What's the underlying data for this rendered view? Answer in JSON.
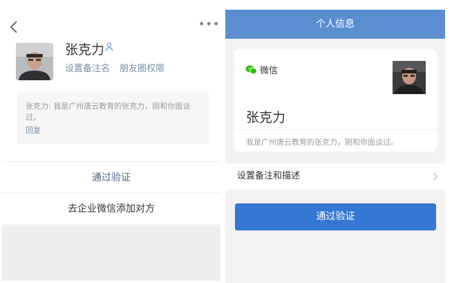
{
  "left_panel": {
    "contact_name": "张克力",
    "set_remark_label": "设置备注名",
    "moments_permission_label": "朋友圈权限",
    "request_message": "张克力: 我是广州唐云教育的张克力，刚和你面谈过。",
    "reply_label": "回复",
    "approve_label": "通过验证",
    "add_via_wecom_label": "去企业微信添加对方"
  },
  "right_panel": {
    "header_title": "个人信息",
    "app_name": "微信",
    "contact_name": "张克力",
    "description": "我是广州唐云教育的张克力，刚和你面谈过。",
    "set_remark_desc_label": "设置备注和描述",
    "approve_button_label": "通过验证"
  },
  "colors": {
    "header_bg": "#5b8ed0",
    "primary_button": "#3478d4",
    "link_text": "#7a8ea9",
    "wechat_green": "#2dc100"
  },
  "icons": [
    "back-arrow-icon",
    "more-icon",
    "person-icon",
    "wechat-icon",
    "chevron-right-icon"
  ]
}
